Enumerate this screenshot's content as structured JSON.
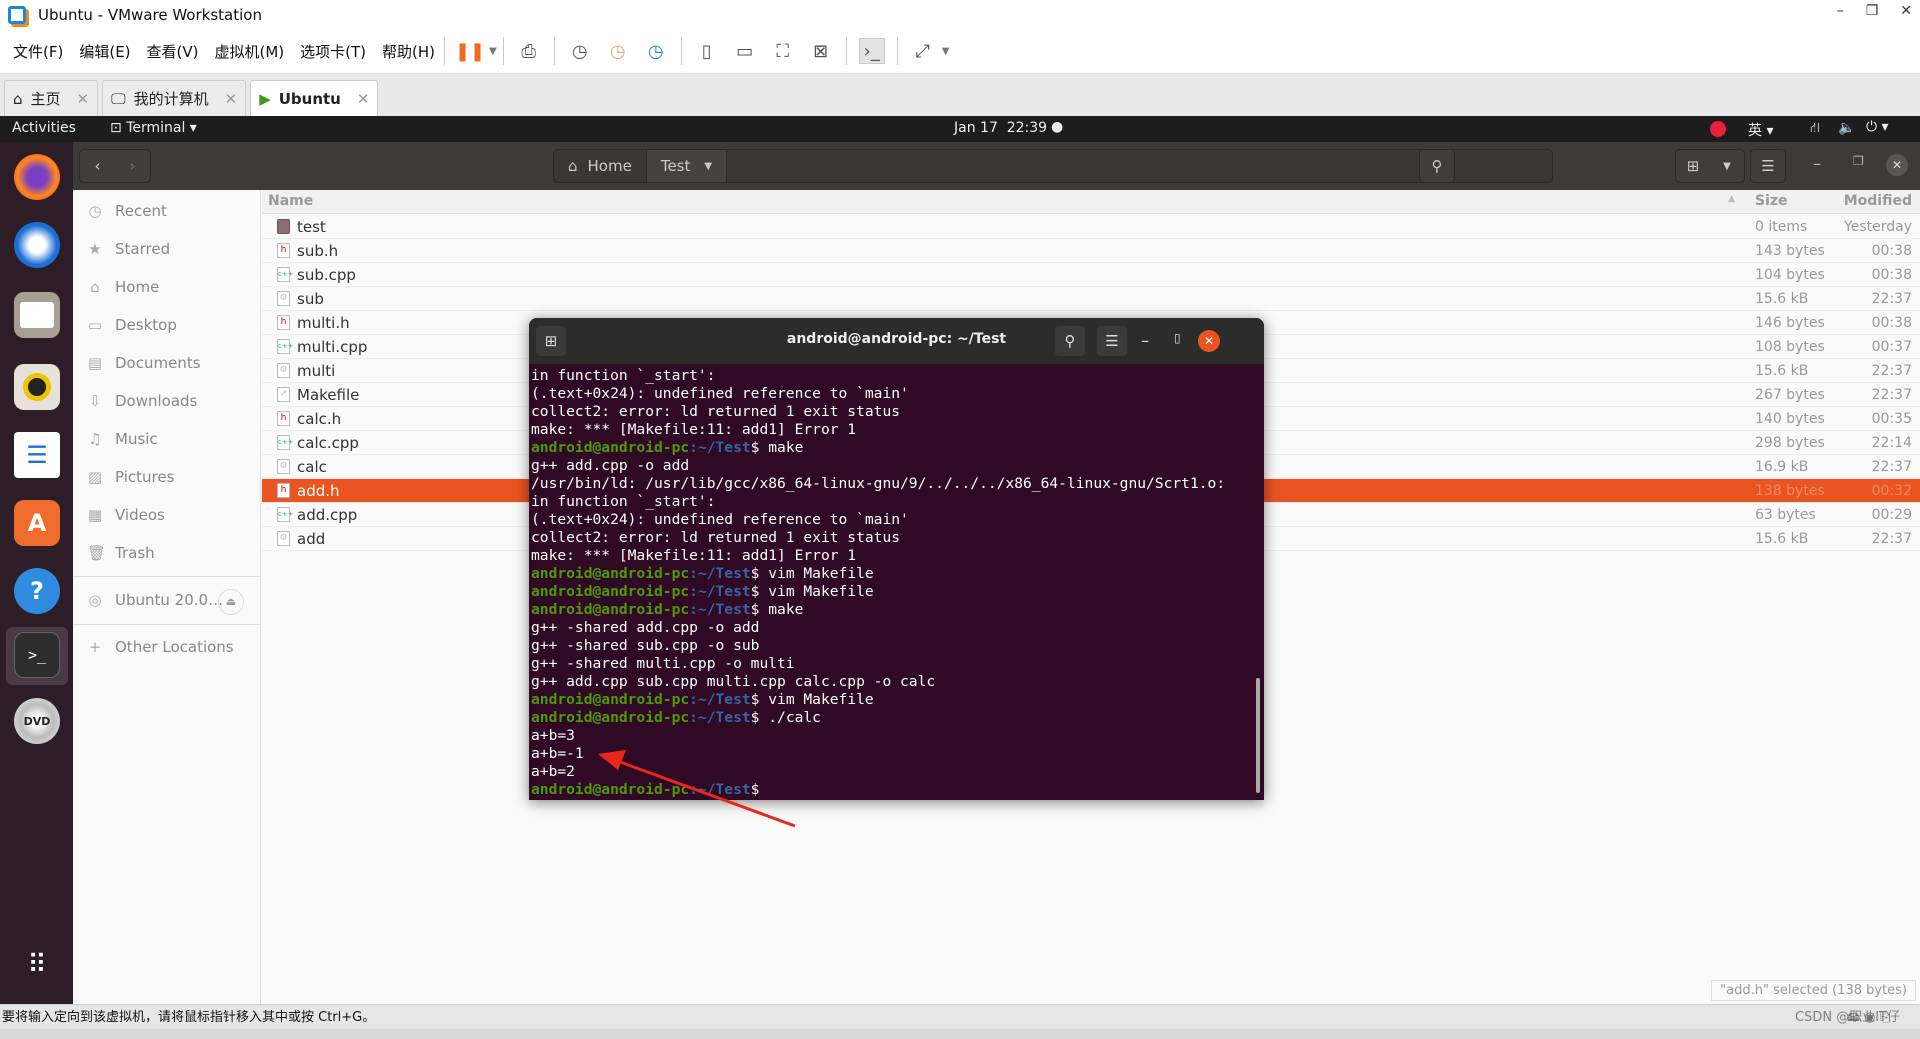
{
  "window": {
    "title": "Ubuntu - VMware Workstation"
  },
  "menu": [
    "文件(F)",
    "编辑(E)",
    "查看(V)",
    "虚拟机(M)",
    "选项卡(T)",
    "帮助(H)"
  ],
  "tabs": [
    {
      "label": "主页",
      "icon": "home-icon"
    },
    {
      "label": "我的计算机",
      "icon": "monitor-icon"
    },
    {
      "label": "Ubuntu",
      "icon": "vm-running-icon",
      "active": true
    }
  ],
  "topbar": {
    "activities": "Activities",
    "app": "Terminal",
    "clock": "Jan 17  22:39",
    "ime": "英"
  },
  "nautilus": {
    "path": [
      "Home",
      "Test"
    ],
    "sidebar": [
      "Recent",
      "Starred",
      "Home",
      "Desktop",
      "Documents",
      "Downloads",
      "Music",
      "Pictures",
      "Videos",
      "Trash"
    ],
    "device": "Ubuntu 20.0…",
    "other": "Other Locations",
    "columns": {
      "name": "Name",
      "size": "Size",
      "modified": "Modified"
    },
    "files": [
      {
        "name": "test",
        "type": "folder",
        "size": "0 items",
        "modified": "Yesterday"
      },
      {
        "name": "sub.h",
        "type": "h",
        "size": "143 bytes",
        "modified": "00:38"
      },
      {
        "name": "sub.cpp",
        "type": "cpp",
        "size": "104 bytes",
        "modified": "00:38"
      },
      {
        "name": "sub",
        "type": "exe",
        "size": "15.6 kB",
        "modified": "22:37"
      },
      {
        "name": "multi.h",
        "type": "h",
        "size": "146 bytes",
        "modified": "00:38"
      },
      {
        "name": "multi.cpp",
        "type": "cpp",
        "size": "108 bytes",
        "modified": "00:37"
      },
      {
        "name": "multi",
        "type": "exe",
        "size": "15.6 kB",
        "modified": "22:37"
      },
      {
        "name": "Makefile",
        "type": "script",
        "size": "267 bytes",
        "modified": "22:37"
      },
      {
        "name": "calc.h",
        "type": "h",
        "size": "140 bytes",
        "modified": "00:35"
      },
      {
        "name": "calc.cpp",
        "type": "cpp",
        "size": "298 bytes",
        "modified": "22:14"
      },
      {
        "name": "calc",
        "type": "exe",
        "size": "16.9 kB",
        "modified": "22:37"
      },
      {
        "name": "add.h",
        "type": "h",
        "size": "138 bytes",
        "modified": "00:32",
        "selected": true
      },
      {
        "name": "add.cpp",
        "type": "cpp",
        "size": "63 bytes",
        "modified": "00:29"
      },
      {
        "name": "add",
        "type": "exe",
        "size": "15.6 kB",
        "modified": "22:37"
      }
    ],
    "selection_status": "\"add.h\" selected  (138 bytes)"
  },
  "terminal": {
    "title": "android@android-pc: ~/Test",
    "prompt_user": "android@android-pc",
    "prompt_path": ":~/Test",
    "lines": [
      {
        "t": "in function `_start':"
      },
      {
        "t": "(.text+0x24): undefined reference to `main'"
      },
      {
        "t": "collect2: error: ld returned 1 exit status"
      },
      {
        "t": "make: *** [Makefile:11: add1] Error 1"
      },
      {
        "cmd": "make"
      },
      {
        "t": "g++ add.cpp -o add"
      },
      {
        "t": "/usr/bin/ld: /usr/lib/gcc/x86_64-linux-gnu/9/../../../x86_64-linux-gnu/Scrt1.o:"
      },
      {
        "t": "in function `_start':"
      },
      {
        "t": "(.text+0x24): undefined reference to `main'"
      },
      {
        "t": "collect2: error: ld returned 1 exit status"
      },
      {
        "t": "make: *** [Makefile:11: add1] Error 1"
      },
      {
        "cmd": "vim Makefile"
      },
      {
        "cmd": "vim Makefile"
      },
      {
        "cmd": "make"
      },
      {
        "t": "g++ -shared add.cpp -o add"
      },
      {
        "t": "g++ -shared sub.cpp -o sub"
      },
      {
        "t": "g++ -shared multi.cpp -o multi"
      },
      {
        "t": "g++ add.cpp sub.cpp multi.cpp calc.cpp -o calc"
      },
      {
        "cmd": "vim Makefile"
      },
      {
        "cmd": "./calc"
      },
      {
        "t": "a+b=3"
      },
      {
        "t": "a+b=-1"
      },
      {
        "t": "a+b=2"
      },
      {
        "cmd": ""
      }
    ]
  },
  "statusbar": {
    "message": "要将输入定向到该虚拟机，请将鼠标指针移入其中或按 Ctrl+G。",
    "watermark": "CSDN @职业IT仔"
  },
  "colors": {
    "accent": "#e95420",
    "terminal_bg": "#300a24",
    "prompt_user": "#4e9a06",
    "prompt_path": "#3465a4",
    "annotation_arrow": "#e8261c"
  }
}
